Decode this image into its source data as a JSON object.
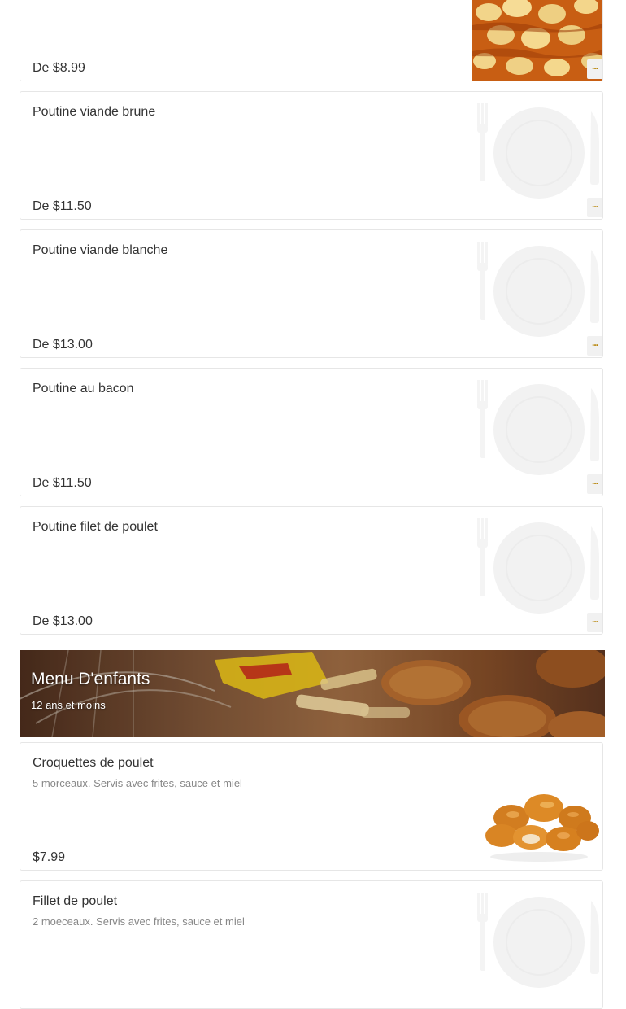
{
  "menu": {
    "items_top": [
      {
        "name": "",
        "price": "De $8.99",
        "image": "poutine-photo",
        "more_label": "..."
      },
      {
        "name": "Poutine viande brune",
        "price": "De $11.50",
        "image": "plate-placeholder-icon",
        "more_label": "..."
      },
      {
        "name": "Poutine viande blanche",
        "price": "De $13.00",
        "image": "plate-placeholder-icon",
        "more_label": "..."
      },
      {
        "name": "Poutine au bacon",
        "price": "De $11.50",
        "image": "plate-placeholder-icon",
        "more_label": "..."
      },
      {
        "name": "Poutine filet de poulet",
        "price": "De $13.00",
        "image": "plate-placeholder-icon",
        "more_label": "..."
      }
    ],
    "section": {
      "title": "Menu D'enfants",
      "subtitle": "12 ans et moins"
    },
    "items_kids": [
      {
        "name": "Croquettes de poulet",
        "description": "5 morceaux. Servis avec frites, sauce et miel",
        "price": "$7.99",
        "image": "chicken-nuggets-photo"
      },
      {
        "name": "Fillet de poulet",
        "description": "2 moeceaux. Servis avec frites, sauce et miel",
        "price": "",
        "image": "plate-placeholder-icon"
      }
    ]
  },
  "colors": {
    "card_border": "#e6e6e6",
    "more_button_bg": "#f1f1f1",
    "more_button_dots": "#b8860b",
    "text": "#333333",
    "description": "#888888"
  }
}
